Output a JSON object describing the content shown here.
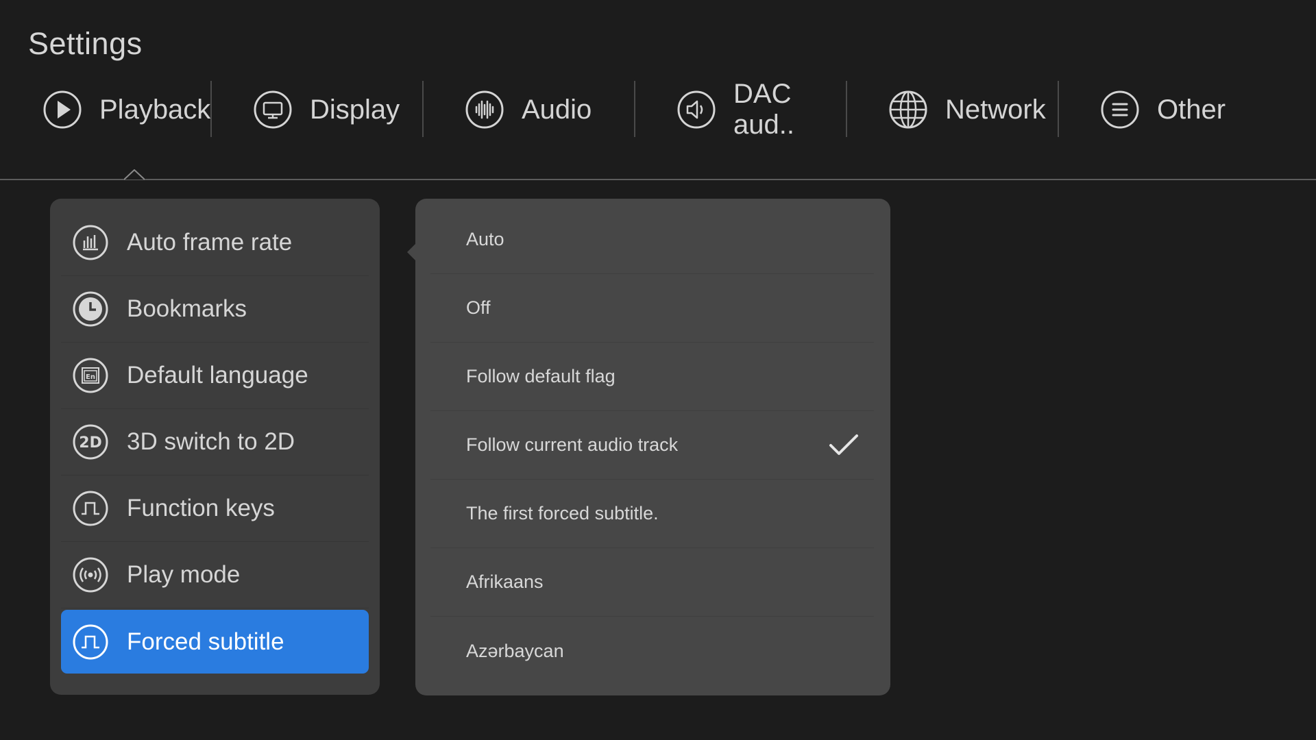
{
  "header": {
    "title": "Settings"
  },
  "tabs": [
    {
      "label": "Playback",
      "icon": "play-icon"
    },
    {
      "label": "Display",
      "icon": "monitor-icon"
    },
    {
      "label": "Audio",
      "icon": "waveform-icon"
    },
    {
      "label": "DAC aud..",
      "icon": "speaker-icon"
    },
    {
      "label": "Network",
      "icon": "globe-icon"
    },
    {
      "label": "Other",
      "icon": "list-icon"
    }
  ],
  "active_tab": "Playback",
  "menu": {
    "items": [
      {
        "label": "Auto frame rate",
        "icon": "bar-chart-icon"
      },
      {
        "label": "Bookmarks",
        "icon": "clock-icon"
      },
      {
        "label": "Default language",
        "icon": "language-icon"
      },
      {
        "label": "3D switch to 2D",
        "icon": "2d-icon"
      },
      {
        "label": "Function keys",
        "icon": "pulse-icon"
      },
      {
        "label": "Play mode",
        "icon": "broadcast-icon"
      },
      {
        "label": "Forced subtitle",
        "icon": "pulse-icon"
      }
    ],
    "selected": "Forced subtitle"
  },
  "options": {
    "items": [
      {
        "label": "Auto"
      },
      {
        "label": "Off"
      },
      {
        "label": "Follow default flag"
      },
      {
        "label": "Follow current audio track"
      },
      {
        "label": "The first forced subtitle."
      },
      {
        "label": "Afrikaans"
      },
      {
        "label": "Azərbaycan"
      }
    ],
    "checked": "Follow current audio track"
  },
  "colors": {
    "background": "#1c1c1c",
    "panel": "#3d3d3d",
    "options_panel": "#474747",
    "accent": "#2a7ce0",
    "text": "#d6d6d6"
  }
}
